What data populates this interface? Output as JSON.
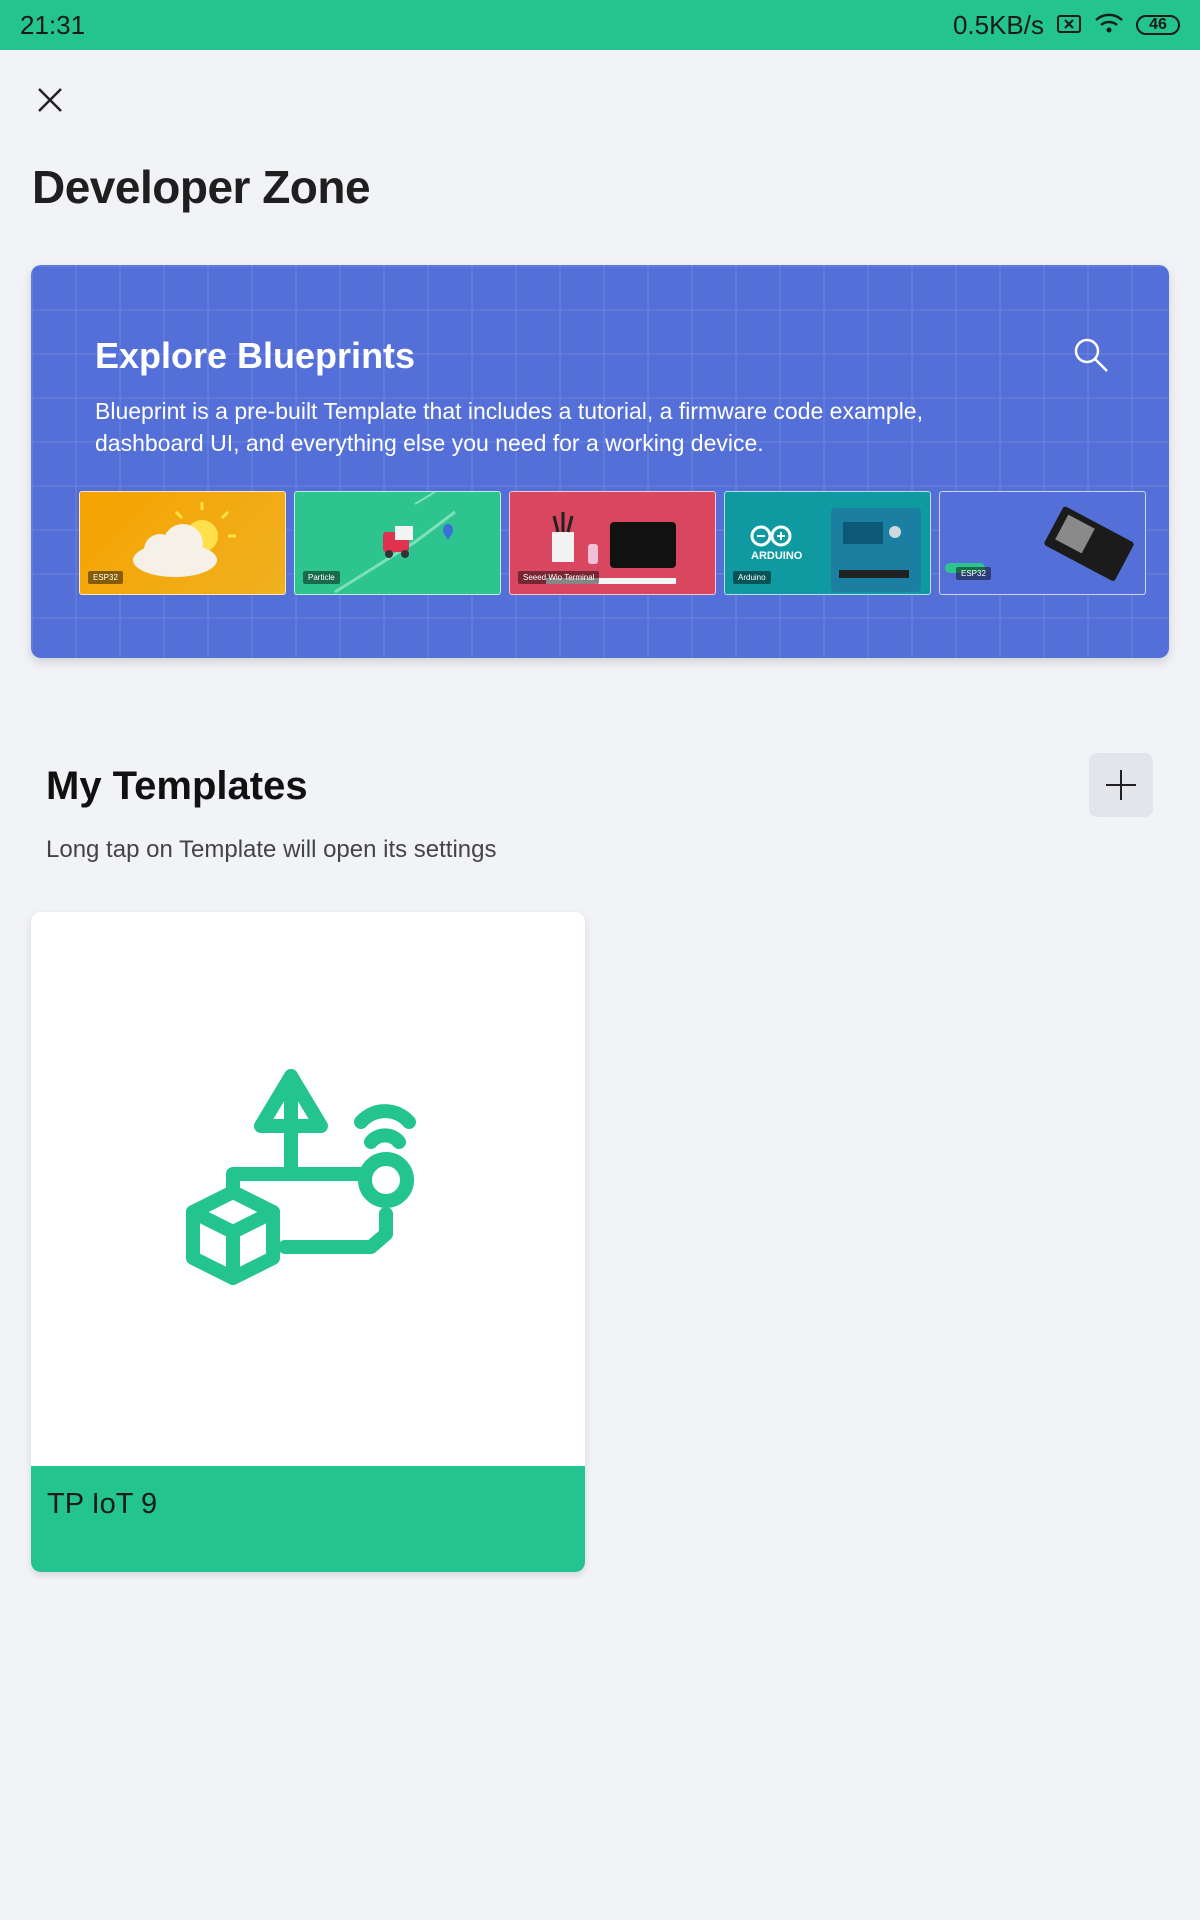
{
  "status_bar": {
    "time": "21:31",
    "network_speed": "0.5KB/s",
    "battery": "46",
    "icons": [
      "sim-x-icon",
      "wifi-icon",
      "battery-icon"
    ]
  },
  "header": {
    "close_icon": "close-icon",
    "title": "Developer Zone"
  },
  "blueprints": {
    "title": "Explore Blueprints",
    "description": "Blueprint is a pre-built Template that includes a tutorial, a firmware code example, dashboard UI, and everything else you need for a working device.",
    "search_icon": "search-icon",
    "thumbnails": [
      {
        "tag": "ESP32",
        "color": "#f0a30a"
      },
      {
        "tag": "Particle",
        "color": "#2ec48f"
      },
      {
        "tag": "Seeed Wio Terminal",
        "color": "#d9465f"
      },
      {
        "tag": "Arduino",
        "logo_text": "ARDUINO",
        "color": "#0e9aa0"
      },
      {
        "tag": "ESP32",
        "color": "#5470d8"
      }
    ]
  },
  "my_templates": {
    "title": "My Templates",
    "subtitle": "Long tap on Template will open its settings",
    "add_icon": "plus-icon",
    "templates": [
      {
        "name": "TP IoT 9",
        "icon": "template-icon"
      }
    ]
  },
  "colors": {
    "accent": "#23c48e",
    "banner": "#5470d8",
    "background": "#f2f3f7"
  }
}
